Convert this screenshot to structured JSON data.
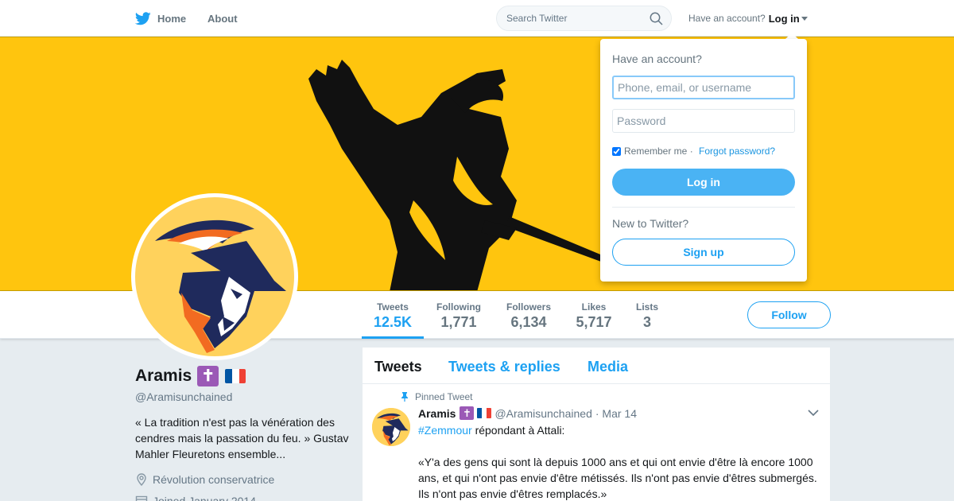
{
  "nav": {
    "home_label": "Home",
    "about_label": "About",
    "search_placeholder": "Search Twitter",
    "have_account_text": "Have an account?",
    "login_label": "Log in"
  },
  "colors": {
    "accent": "#1da1f2",
    "banner": "#ffc50e",
    "avatar_bg": "#ffd25c",
    "cross_badge": "#9b59b6"
  },
  "profile_nav": {
    "stats": [
      {
        "label": "Tweets",
        "value": "12.5K"
      },
      {
        "label": "Following",
        "value": "1,771"
      },
      {
        "label": "Followers",
        "value": "6,134"
      },
      {
        "label": "Likes",
        "value": "5,717"
      },
      {
        "label": "Lists",
        "value": "3"
      }
    ],
    "follow_label": "Follow"
  },
  "profile": {
    "name": "Aramis",
    "cross_emoji": "✝",
    "handle": "@Aramisunchained",
    "bio": "« La tradition n'est pas la vénération des cendres mais la passation du feu. » Gustav Mahler Fleuretons ensemble...",
    "location": "Révolution conservatrice",
    "joined": "Joined January 2014"
  },
  "timeline": {
    "tabs": [
      "Tweets",
      "Tweets & replies",
      "Media"
    ],
    "pinned_label": "Pinned Tweet",
    "tweet": {
      "name": "Aramis",
      "handle": "@Aramisunchained",
      "date": "· Mar 14",
      "hashtag": "#Zemmour",
      "line1_rest": " répondant à Attali:",
      "quote": "«Y'a des gens qui sont là depuis 1000 ans et qui ont envie d'être là encore 1000 ans, et qui n'ont pas envie d'être métissés. Ils n'ont pas envie d'êtres submergés. Ils n'ont pas envie d'êtres remplacés.»"
    }
  },
  "login_dropdown": {
    "title": "Have an account?",
    "username_placeholder": "Phone, email, or username",
    "password_placeholder": "Password",
    "remember_label": "Remember me",
    "separator": " · ",
    "forgot_label": "Forgot password?",
    "login_button": "Log in",
    "new_to_twitter": "New to Twitter?",
    "signup_button": "Sign up"
  }
}
